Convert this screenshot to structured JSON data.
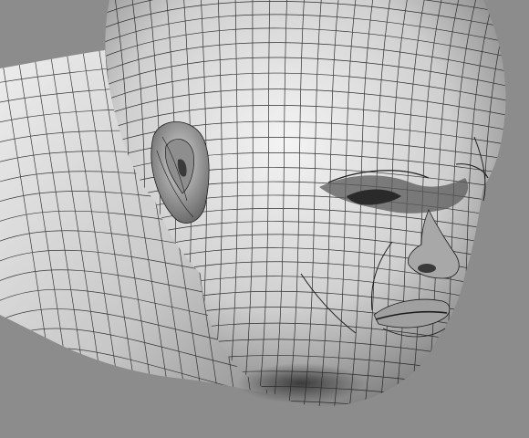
{
  "scene": {
    "subject": "head-sculpt-wireframe",
    "background_color": "#8c8c8c",
    "mesh_line_color": "#1e1e1e",
    "surface_light_color": "#f2f2f2",
    "surface_mid_color": "#b4b4b4",
    "surface_dark_color": "#3c3c3c"
  }
}
